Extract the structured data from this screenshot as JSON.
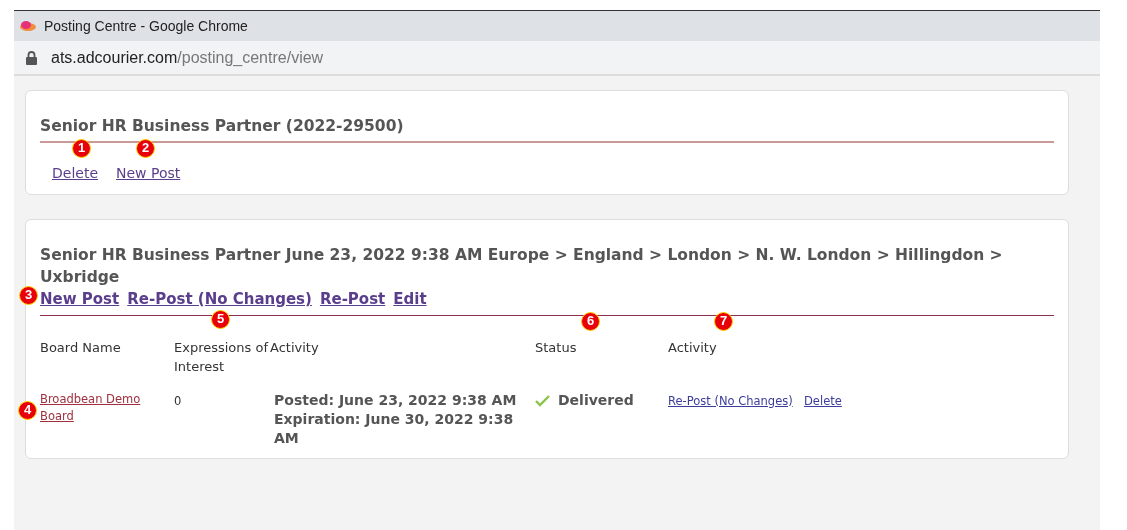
{
  "window": {
    "title": "Posting Centre - Google Chrome"
  },
  "address_bar": {
    "domain": "ats.adcourier.com",
    "path": "/posting_centre/view"
  },
  "job_card": {
    "title": "Senior HR Business Partner (2022-29500)",
    "links": [
      {
        "label": "Delete",
        "marker": "1"
      },
      {
        "label": "New Post",
        "marker": "2"
      }
    ]
  },
  "posting_card": {
    "title": "Senior HR Business Partner June 23, 2022 9:38 AM Europe > England > London > N. W. London > Hillingdon > Uxbridge",
    "links": [
      {
        "label": "New Post",
        "marker": "3"
      },
      {
        "label": "Re-Post (No Changes)",
        "marker": "5"
      },
      {
        "label": "Re-Post"
      },
      {
        "label": "Edit"
      }
    ],
    "table": {
      "columns": [
        {
          "label": "Board Name"
        },
        {
          "label": "Expressions of Interest"
        },
        {
          "label": "Activity"
        },
        {
          "label": "Status",
          "marker": "6"
        },
        {
          "label": "Activity",
          "marker": "7"
        }
      ],
      "rows": [
        {
          "board": "Broadbean Demo Board",
          "board_marker": "4",
          "expressions": "0",
          "posted": "Posted: June 23, 2022 9:38 AM",
          "expiration": "Expiration: June 30, 2022 9:38 AM",
          "status": "Delivered",
          "delivered": true,
          "actions": [
            "Re-Post (No Changes)",
            "Delete"
          ]
        }
      ]
    }
  }
}
